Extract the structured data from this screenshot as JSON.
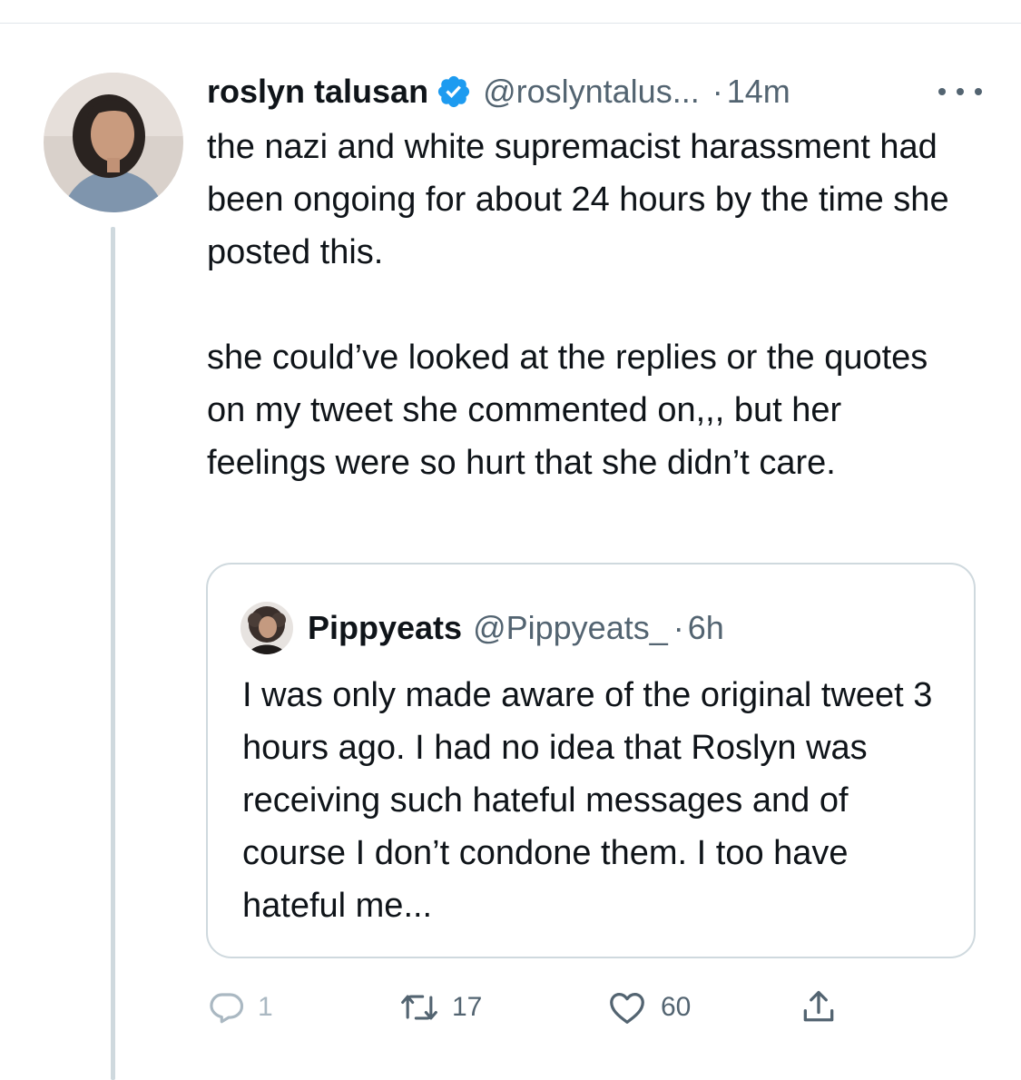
{
  "tweet": {
    "author": {
      "display_name": "roslyn talusan",
      "handle": "@roslyntalus...",
      "avatar": "avatar-photo",
      "verified": true
    },
    "separator": "·",
    "timestamp": "14m",
    "more_icon": "more-horizontal-icon",
    "text": "the nazi and white supremacist harassment had been ongoing for about 24 hours by the time she posted this.\n\nshe could’ve looked at the replies or the quotes on my tweet she commented on,,, but her feelings were so hurt that she didn’t care."
  },
  "quoted_tweet": {
    "author": {
      "display_name": "Pippyeats",
      "handle": "@Pippyeats_",
      "avatar": "avatar-photo"
    },
    "separator": "·",
    "timestamp": "6h",
    "text": "I was only made aware of the original tweet 3 hours ago. I had no idea that Roslyn was receiving such hateful messages and of course I don’t condone them. I too have hateful me..."
  },
  "actions": {
    "reply": {
      "icon": "reply-icon",
      "count": "1"
    },
    "retweet": {
      "icon": "retweet-icon",
      "count": "17"
    },
    "like": {
      "icon": "heart-icon",
      "count": "60"
    },
    "share": {
      "icon": "share-icon"
    }
  },
  "colors": {
    "verified": "#1d9bf0",
    "text": "#0f1419",
    "muted": "#536471",
    "border": "#cfd9de",
    "thread_line": "#cfd9de"
  }
}
